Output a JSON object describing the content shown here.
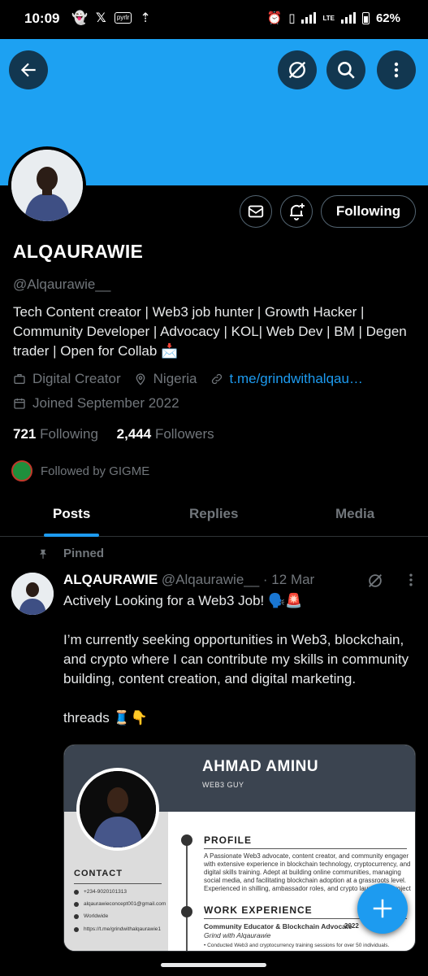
{
  "status_bar": {
    "time": "10:09",
    "mini_icon_text": "pyrlr",
    "lte_label": "LTE",
    "battery": "62%"
  },
  "colors": {
    "banner": "#1da1f2",
    "accent": "#1d9bf0",
    "background": "#000000"
  },
  "header": {
    "back_icon": "arrow-left-icon",
    "actions": [
      "grok-icon",
      "search-icon",
      "more-icon"
    ]
  },
  "profile": {
    "name": "ALQAURAWIE",
    "handle": "@Alqaurawie__",
    "bio": "Tech Content creator | Web3 job hunter | Growth Hacker | Community Developer | Advocacy | KOL| Web Dev | BM | Degen trader | Open for Collab 📩",
    "category": "Digital Creator",
    "location": "Nigeria",
    "link": "t.me/grindwithalqau…",
    "joined": "Joined September 2022",
    "following_count": "721",
    "following_label": "Following",
    "followers_count": "2,444",
    "followers_label": "Followers",
    "followed_by": "Followed by GIGME",
    "follow_button": "Following"
  },
  "tabs": [
    {
      "label": "Posts",
      "active": true
    },
    {
      "label": "Replies",
      "active": false
    },
    {
      "label": "Media",
      "active": false
    }
  ],
  "post": {
    "pinned_label": "Pinned",
    "author": "ALQAURAWIE",
    "handle": "@Alqaurawie__",
    "date": "· 12 Mar",
    "line1": "Actively Looking for a Web3 Job! 🗣️🚨",
    "line2": "I’m currently seeking opportunities in Web3, blockchain, and crypto where I can contribute my skills in community building, content creation, and digital marketing.",
    "line3": "threads 🧵👇"
  },
  "resume": {
    "name": "AHMAD AMINU",
    "subtitle": "WEB3 GUY",
    "profile_heading": "PROFILE",
    "profile_text": "A Passionate Web3 advocate, content creator, and community engager with extensive experience in blockchain technology, cryptocurrency, and digital skills training. Adept at building online communities, managing social media, and facilitating blockchain adoption at a grassroots level. Experienced in shilling, ambassador roles, and crypto launchpad project promotions.",
    "work_heading": "WORK EXPERIENCE",
    "job_title": "Community Educator & Blockchain Advocate",
    "job_org": "Grind with Alqaurawie",
    "job_year": "2022",
    "job_bullet": "• Conducted Web3 and cryptocurrency training sessions for over 50 individuals.",
    "contact_heading": "CONTACT",
    "phone": "+234-9020101313",
    "email": "alqaurawieconcept001@gmail.com",
    "location": "Worldwide",
    "telegram": "https://t.me/grindwithalqaurawie1"
  }
}
